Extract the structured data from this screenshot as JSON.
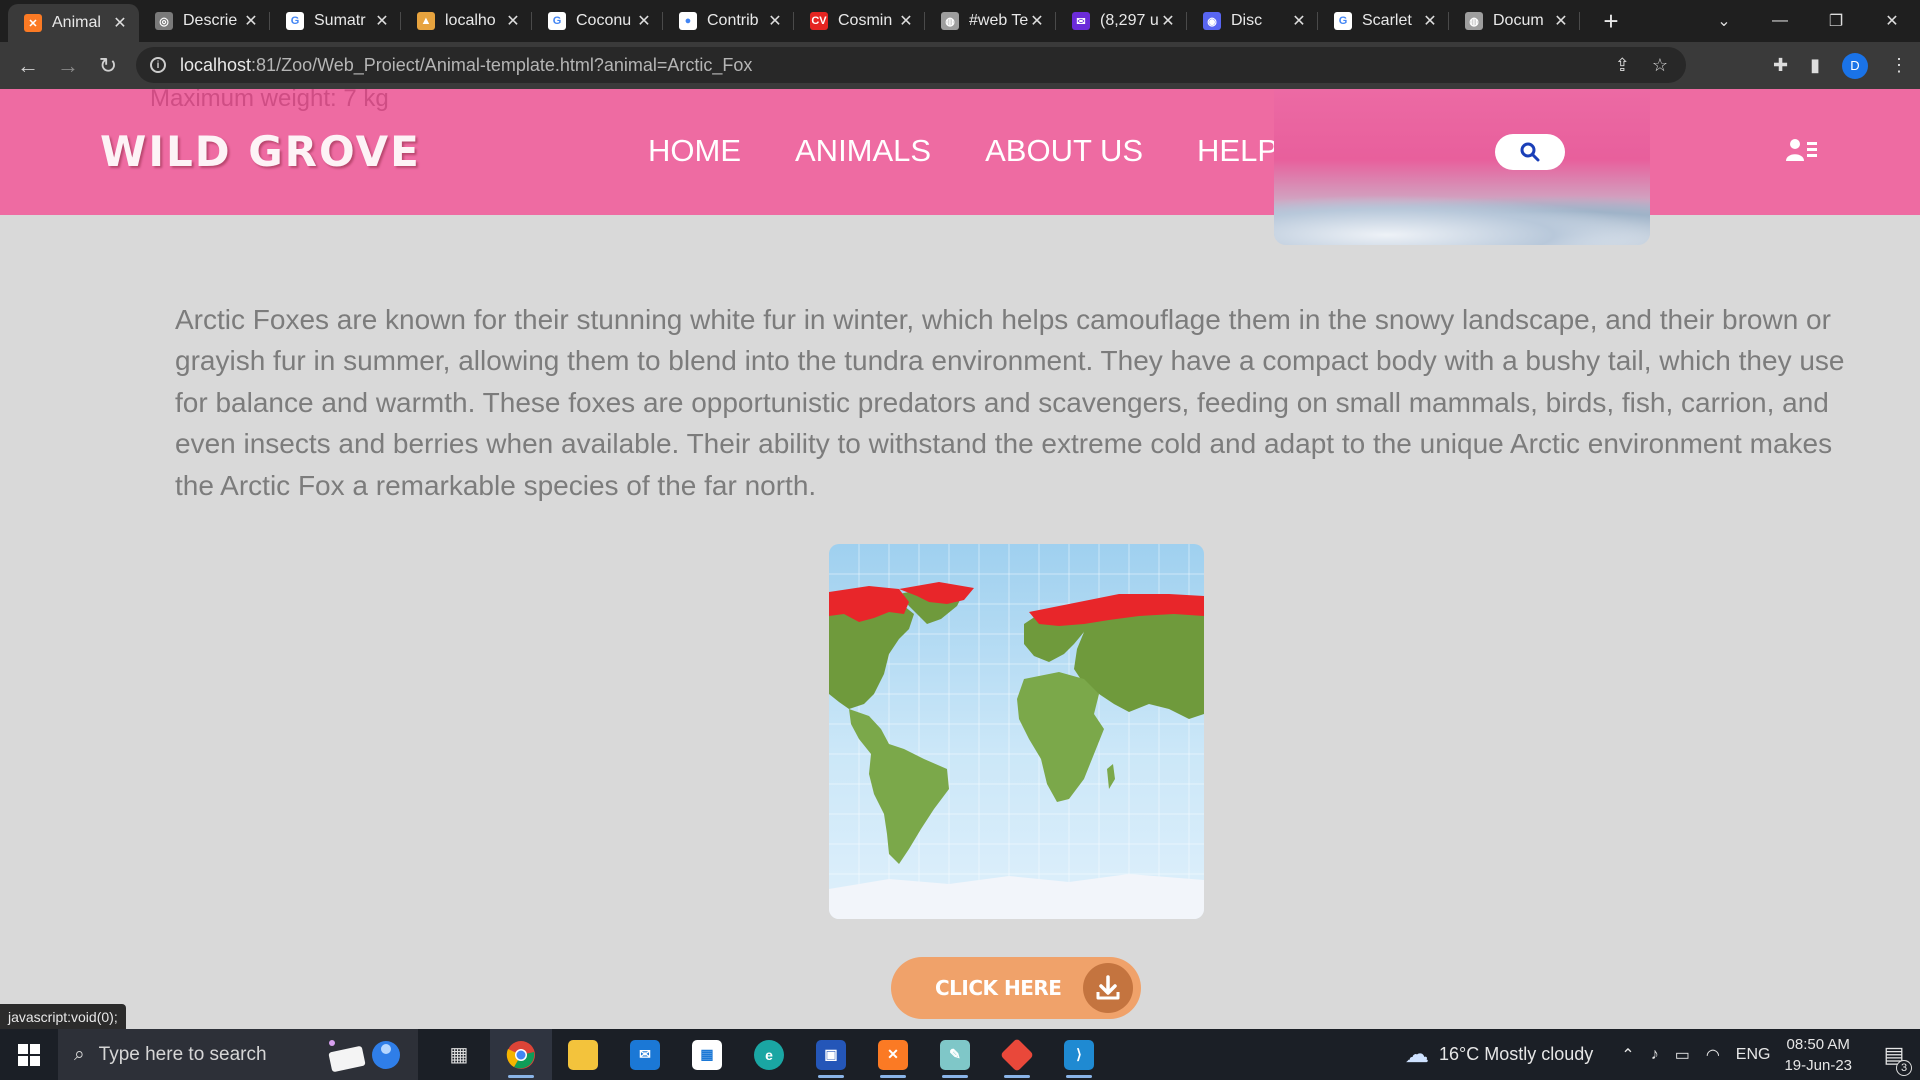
{
  "browser": {
    "tabs": [
      {
        "title": "Animal",
        "icon": "xampp-icon",
        "color": "#fb7a24",
        "glyph": "✕",
        "active": true
      },
      {
        "title": "Descrie",
        "icon": "openai-icon",
        "color": "#7a7a7a",
        "glyph": "◎"
      },
      {
        "title": "Sumatr",
        "icon": "google-icon",
        "color": "#ffffff",
        "glyph": "G"
      },
      {
        "title": "localho",
        "icon": "localhost-icon",
        "color": "#e7a33e",
        "glyph": "▲"
      },
      {
        "title": "Coconu",
        "icon": "google-icon",
        "color": "#ffffff",
        "glyph": "G"
      },
      {
        "title": "Contrib",
        "icon": "github-icon",
        "color": "#ffffff",
        "glyph": "●"
      },
      {
        "title": "Cosmin",
        "icon": "cv-icon",
        "color": "#e52521",
        "glyph": "CV"
      },
      {
        "title": "#web Te",
        "icon": "globe-icon",
        "color": "#9e9e9e",
        "glyph": "◍"
      },
      {
        "title": "(8,297 u",
        "icon": "mail-icon",
        "color": "#6b2bd9",
        "glyph": "✉"
      },
      {
        "title": "Disc",
        "icon": "discord-icon",
        "color": "#5865f2",
        "glyph": "◉"
      },
      {
        "title": "Scarlet",
        "icon": "google-icon",
        "color": "#ffffff",
        "glyph": "G"
      },
      {
        "title": "Docum",
        "icon": "globe-icon",
        "color": "#9e9e9e",
        "glyph": "◍"
      }
    ],
    "new_tab": "+",
    "url_host": "localhost",
    "url_path": ":81/Zoo/Web_Proiect/Animal-template.html?animal=Arctic_Fox",
    "profile_initial": "D",
    "status_text": "javascript:void(0);"
  },
  "site": {
    "scrolled_text": "Maximum weight: 7 kg",
    "logo": "WILD GROVE",
    "nav": [
      "HOME",
      "ANIMALS",
      "ABOUT US",
      "HELP"
    ],
    "description": "Arctic Foxes are known for their stunning white fur in winter, which helps camouflage them in the snowy landscape, and their brown or grayish fur in summer, allowing them to blend into the tundra environment. They have a compact body with a bushy tail, which they use for balance and warmth. These foxes are opportunistic predators and scavengers, feeding on small mammals, birds, fish, carrion, and even insects and berries when available. Their ability to withstand the extreme cold and adapt to the unique Arctic environment makes the Arctic Fox a remarkable species of the far north.",
    "download_label": "CLICK HERE",
    "colors": {
      "header": "#ee6ba2",
      "button": "#f0a26a",
      "range": "#e8262a",
      "land": "#6f9a3c"
    }
  },
  "taskbar": {
    "search_placeholder": "Type here to search",
    "weather": "16°C  Mostly cloudy",
    "language": "ENG",
    "time": "08:50 AM",
    "date": "19-Jun-23",
    "notifications": "3"
  }
}
